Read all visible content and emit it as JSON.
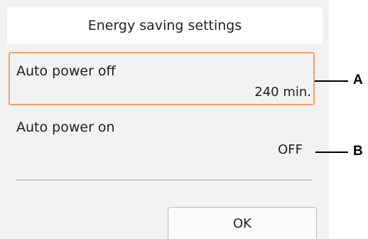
{
  "title": "Energy saving settings",
  "settings": [
    {
      "label": "Auto power off",
      "value": "240 min.",
      "selected": true
    },
    {
      "label": "Auto power on",
      "value": "OFF",
      "selected": false
    }
  ],
  "ok_label": "OK",
  "callouts": [
    "A",
    "B"
  ],
  "colors": {
    "selection_border": "#f0a06a",
    "screen_background": "#f2f2f2",
    "title_background": "#ffffff"
  }
}
